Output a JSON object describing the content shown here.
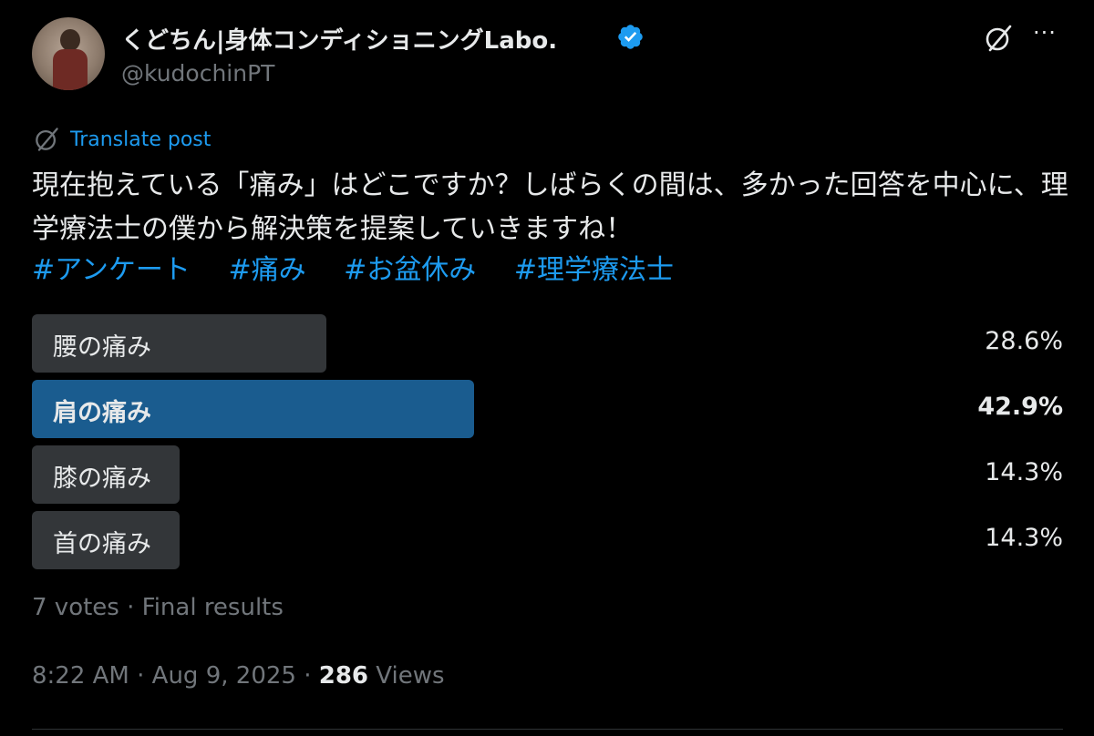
{
  "author": {
    "name": "くどちん|身体コンディショニングLabo.",
    "handle": "@kudochinPT"
  },
  "icons": {
    "verified": "verified-badge-icon",
    "grok": "grok-icon",
    "more": "more-icon",
    "translate": "grok-icon"
  },
  "header": {
    "more": "···"
  },
  "translate_label": "Translate post",
  "post_text": "現在抱えている「痛み」はどこですか？しばらくの間は、多かった回答を中心に、理学療法士の僕から解決策を提案していきますね！",
  "hashtags": [
    "#アンケート",
    "#痛み",
    "#お盆休み",
    "#理学療法士"
  ],
  "poll": {
    "options": [
      {
        "label": "腰の痛み",
        "percent": "28.6%",
        "value": 28.6,
        "winner": false
      },
      {
        "label": "肩の痛み",
        "percent": "42.9%",
        "value": 42.9,
        "winner": true
      },
      {
        "label": "膝の痛み",
        "percent": "14.3%",
        "value": 14.3,
        "winner": false
      },
      {
        "label": "首の痛み",
        "percent": "14.3%",
        "value": 14.3,
        "winner": false
      }
    ],
    "summary": "7 votes · Final results"
  },
  "meta": {
    "time": "8:22 AM",
    "sep1": " · ",
    "date": "Aug 9, 2025",
    "sep2": " · ",
    "views_count": "286",
    "views_label": " Views"
  },
  "colors": {
    "accent": "#1d9bf0",
    "winner_bar": "#1a5c8f",
    "bar": "#333639",
    "muted": "#71767b"
  }
}
